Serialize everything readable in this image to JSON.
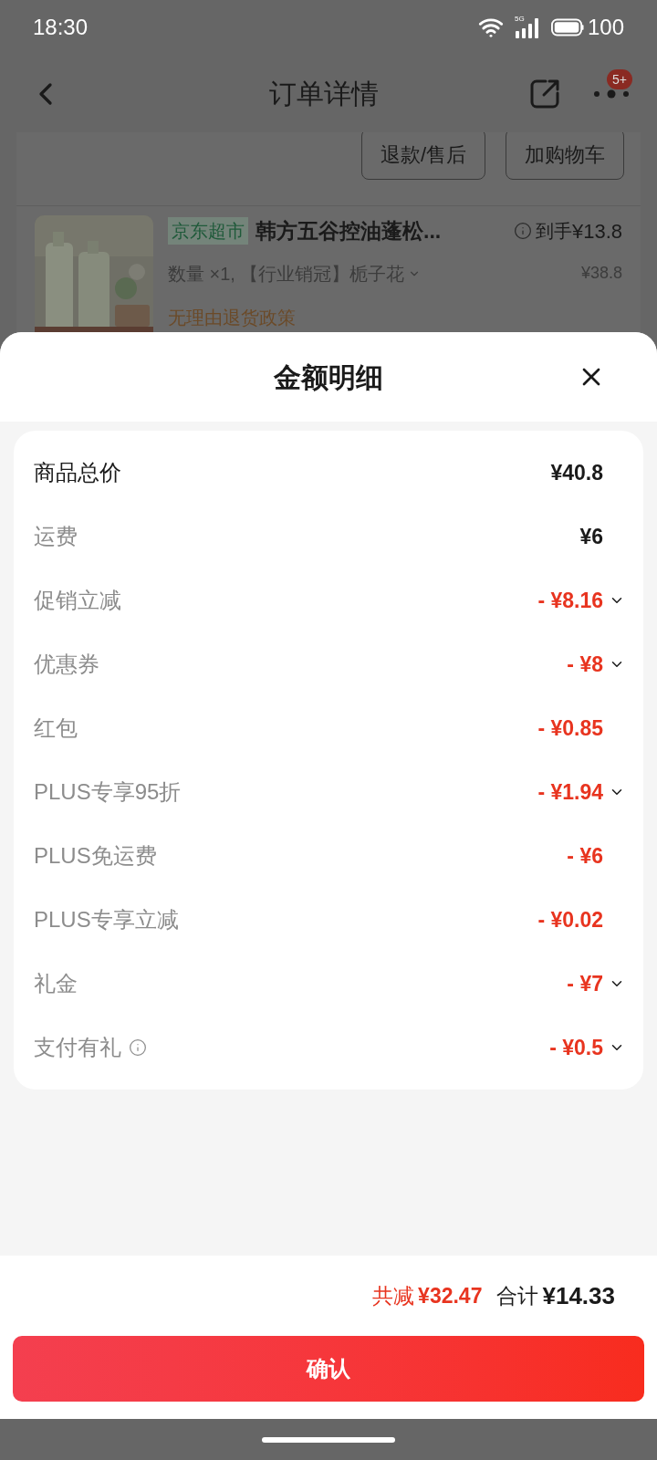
{
  "status_bar": {
    "time": "18:30",
    "network": "5G",
    "battery": "100"
  },
  "nav": {
    "title": "订单详情",
    "badge": "5+"
  },
  "order": {
    "buttons": [
      "退款/售后",
      "加购物车"
    ],
    "product": {
      "kind": "picture",
      "store_tag": "京东超市",
      "name": "韩方五谷控油蓬松...",
      "spec": "数量 ×1, 【行业销冠】栀子花",
      "price_label": "到手",
      "price": "¥13.8",
      "original_price": "¥38.8",
      "policy": "无理由退货政策"
    }
  },
  "sheet": {
    "title": "金额明细",
    "rows": [
      {
        "kind": "total",
        "label": "商品总价",
        "value": "¥40.8",
        "expandable": false,
        "info": false
      },
      {
        "kind": "charge",
        "label": "运费",
        "value": "¥6",
        "expandable": false,
        "info": false
      },
      {
        "kind": "discount",
        "label": "促销立减",
        "value": "- ¥8.16",
        "expandable": true,
        "info": false
      },
      {
        "kind": "discount",
        "label": "优惠券",
        "value": "- ¥8",
        "expandable": true,
        "info": false
      },
      {
        "kind": "discount",
        "label": "红包",
        "value": "- ¥0.85",
        "expandable": false,
        "info": false
      },
      {
        "kind": "discount",
        "label": "PLUS专享95折",
        "value": "- ¥1.94",
        "expandable": true,
        "info": false
      },
      {
        "kind": "discount",
        "label": "PLUS免运费",
        "value": "- ¥6",
        "expandable": false,
        "info": false
      },
      {
        "kind": "discount",
        "label": "PLUS专享立减",
        "value": "- ¥0.02",
        "expandable": false,
        "info": false
      },
      {
        "kind": "discount",
        "label": "礼金",
        "value": "- ¥7",
        "expandable": true,
        "info": false
      },
      {
        "kind": "discount",
        "label": "支付有礼",
        "value": "- ¥0.5",
        "expandable": true,
        "info": true
      }
    ],
    "summary": {
      "saved_label": "共减",
      "saved": "¥32.47",
      "total_label": "合计",
      "total": "¥14.33"
    },
    "confirm": "确认"
  }
}
